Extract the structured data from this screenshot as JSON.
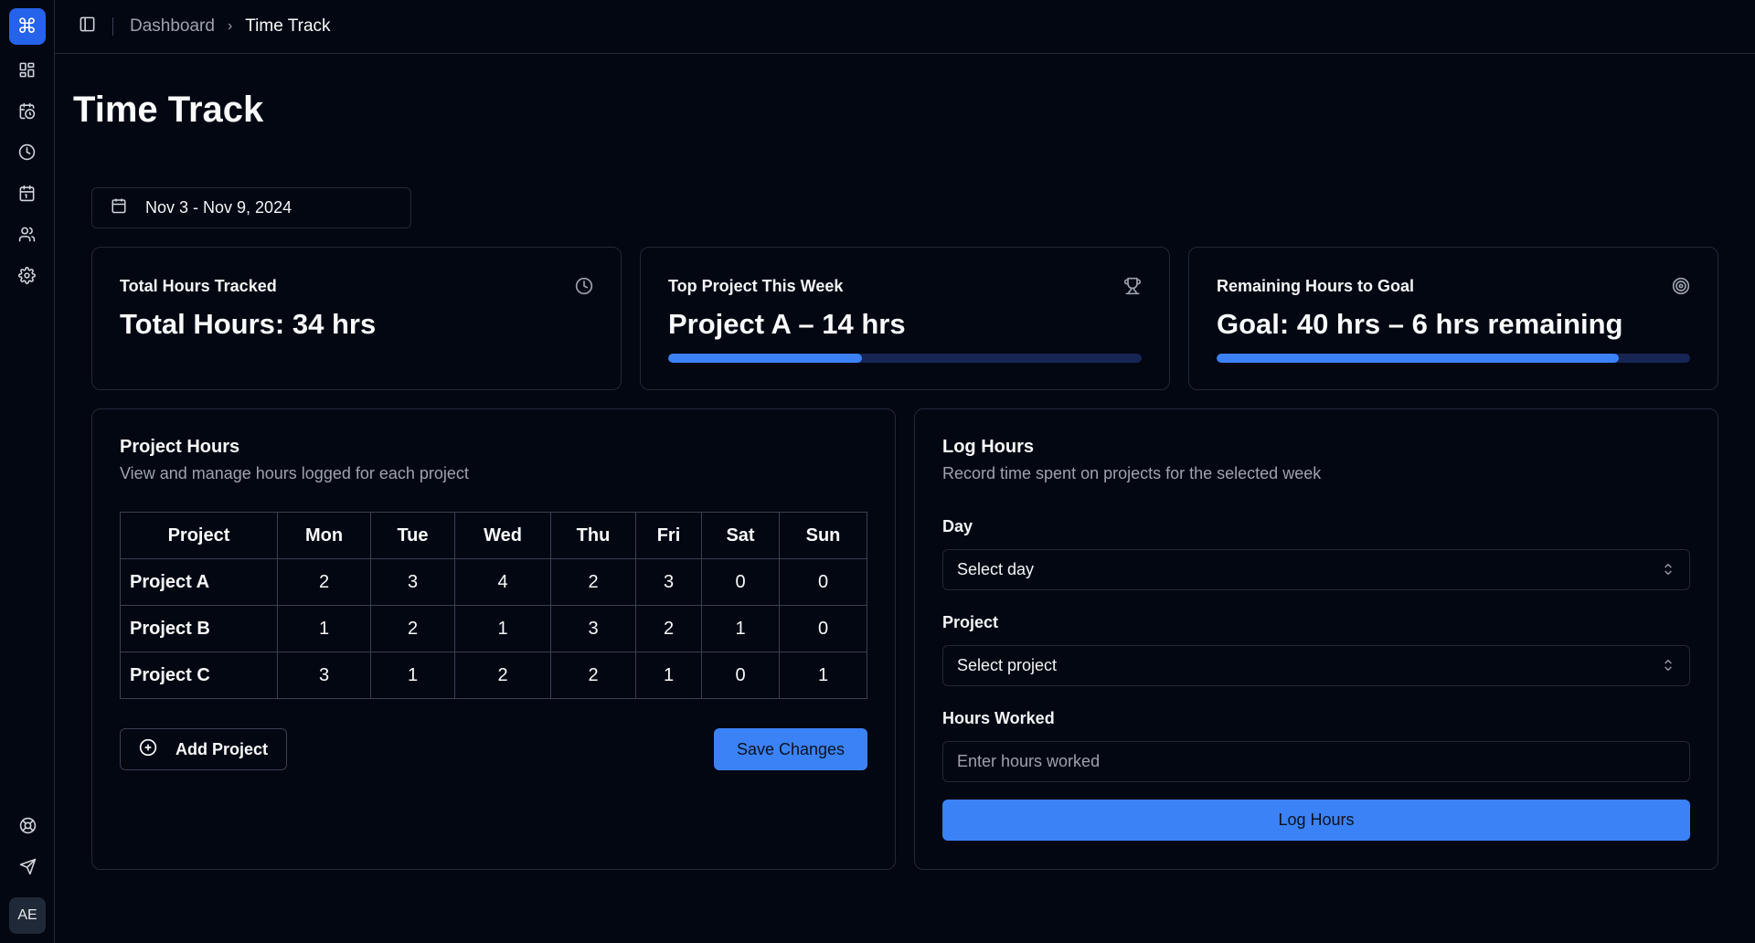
{
  "sidebar": {
    "logo_glyph": "⌘",
    "nav_icons": [
      "dashboard-icon",
      "calendar-clock-icon",
      "clock-icon",
      "calendar-icon",
      "users-icon",
      "settings-icon"
    ],
    "bottom_icons": [
      "help-icon",
      "send-icon"
    ],
    "avatar": "AE"
  },
  "header": {
    "breadcrumb_root": "Dashboard",
    "breadcrumb_current": "Time Track"
  },
  "page": {
    "title": "Time Track",
    "date_range": "Nov 3 - Nov 9, 2024"
  },
  "stats": [
    {
      "title": "Total Hours Tracked",
      "value": "Total Hours: 34 hrs",
      "icon": "clock-icon"
    },
    {
      "title": "Top Project This Week",
      "value": "Project A – 14 hrs",
      "icon": "trophy-icon",
      "progress": 0.41
    },
    {
      "title": "Remaining Hours to Goal",
      "value": "Goal: 40 hrs – 6 hrs remaining",
      "icon": "target-icon",
      "progress": 0.85
    }
  ],
  "project_hours": {
    "title": "Project Hours",
    "description": "View and manage hours logged for each project",
    "columns": [
      "Project",
      "Mon",
      "Tue",
      "Wed",
      "Thu",
      "Fri",
      "Sat",
      "Sun"
    ],
    "rows": [
      [
        "Project A",
        "2",
        "3",
        "4",
        "2",
        "3",
        "0",
        "0"
      ],
      [
        "Project B",
        "1",
        "2",
        "1",
        "3",
        "2",
        "1",
        "0"
      ],
      [
        "Project C",
        "3",
        "1",
        "2",
        "2",
        "1",
        "0",
        "1"
      ]
    ],
    "add_label": "Add Project",
    "save_label": "Save Changes"
  },
  "log_hours": {
    "title": "Log Hours",
    "description": "Record time spent on projects for the selected week",
    "day_label": "Day",
    "day_value": "Select day",
    "project_label": "Project",
    "project_value": "Select project",
    "hours_label": "Hours Worked",
    "hours_placeholder": "Enter hours worked",
    "submit_label": "Log Hours"
  },
  "colors": {
    "accent": "#3b82f6",
    "background": "#030712",
    "border": "#1f2937"
  }
}
